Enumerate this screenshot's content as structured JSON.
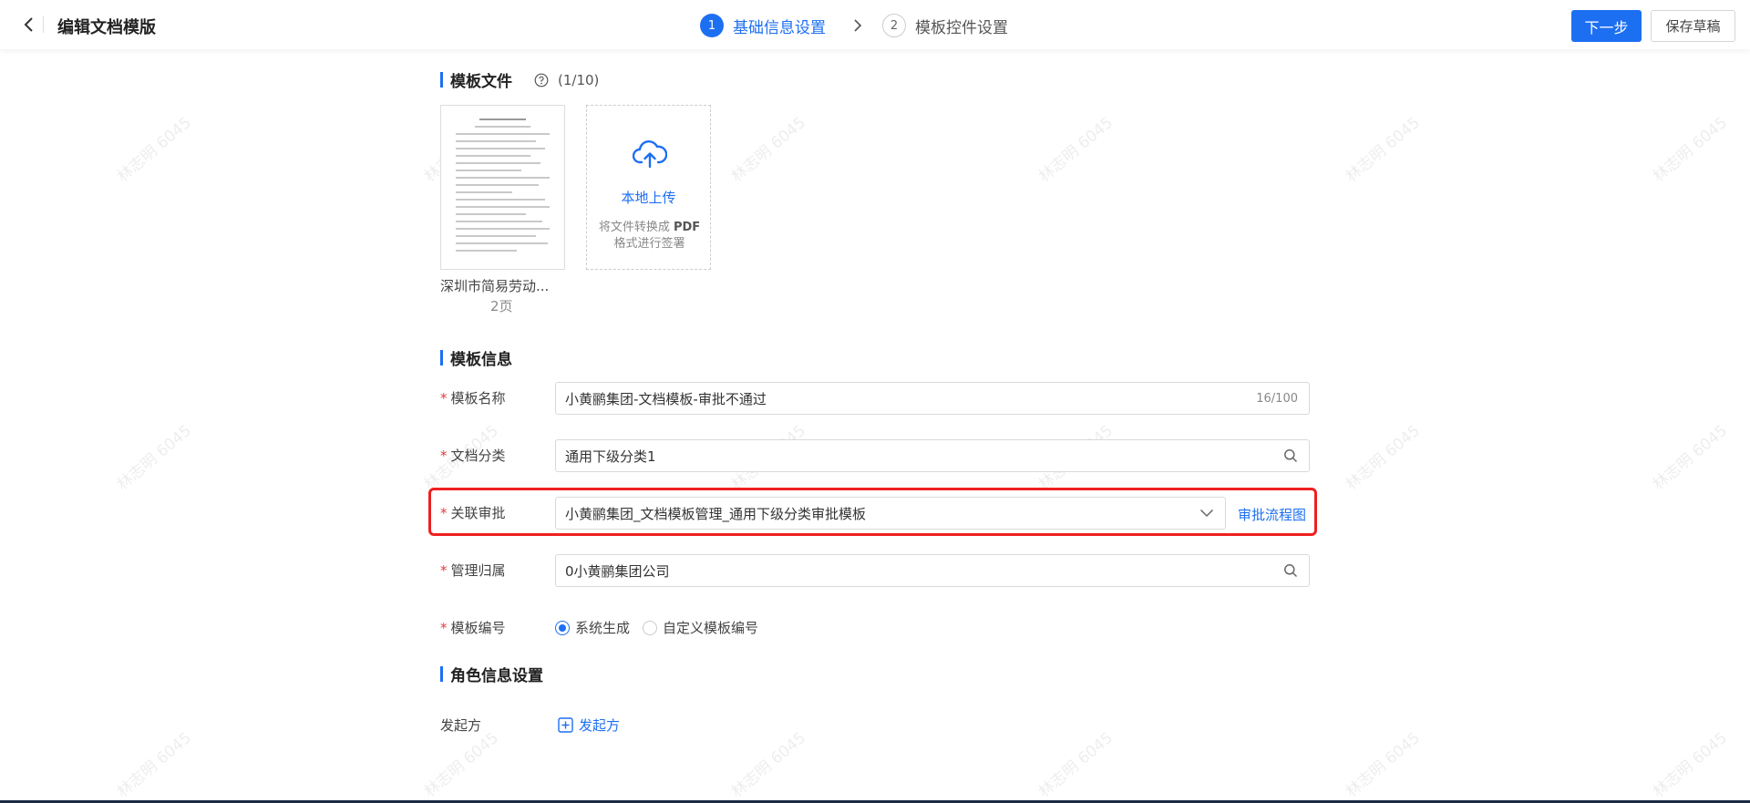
{
  "header": {
    "title": "编辑文档模版",
    "steps": [
      {
        "num": "1",
        "label": "基础信息设置"
      },
      {
        "num": "2",
        "label": "模板控件设置"
      }
    ],
    "next_label": "下一步",
    "save_draft_label": "保存草稿"
  },
  "watermark": "林志明 6045",
  "template_file": {
    "title": "模板文件",
    "count": "(1/10)",
    "file": {
      "name": "深圳市简易劳动...",
      "pages": "2页"
    },
    "upload": {
      "label": "本地上传",
      "hint_prefix": "将文件转换成 ",
      "hint_bold": "PDF",
      "hint_suffix": " 格式进行签署"
    }
  },
  "template_info": {
    "title": "模板信息",
    "required_mark": "*",
    "fields": {
      "name": {
        "label": "模板名称",
        "value": "小黄鹂集团-文档模板-审批不通过",
        "counter": "16/100"
      },
      "category": {
        "label": "文档分类",
        "value": "通用下级分类1"
      },
      "approval": {
        "label": "关联审批",
        "value": "小黄鹂集团_文档模板管理_通用下级分类审批模板",
        "link": "审批流程图"
      },
      "ownership": {
        "label": "管理归属",
        "value": "0小黄鹂集团公司"
      },
      "number": {
        "label": "模板编号",
        "options": [
          "系统生成",
          "自定义模板编号"
        ]
      }
    }
  },
  "role_info": {
    "title": "角色信息设置",
    "initiator_label": "发起方",
    "add_initiator": "发起方"
  },
  "colors": {
    "accent": "#1d6ff2",
    "required": "#e23b3b",
    "highlight": "#ee2020"
  }
}
